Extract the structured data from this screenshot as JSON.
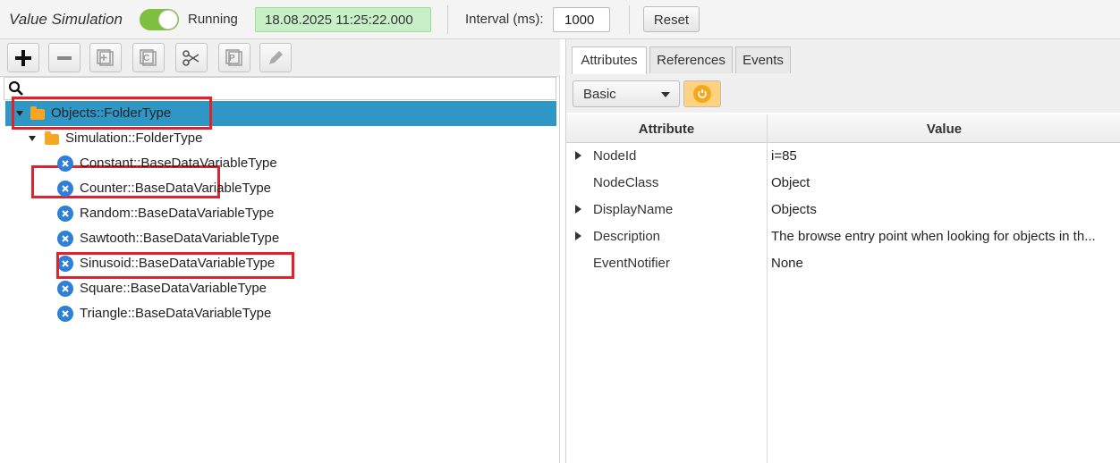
{
  "topbar": {
    "title": "Value Simulation",
    "status": "Running",
    "timestamp": "18.08.2025 11:25:22.000",
    "interval_label": "Interval (ms):",
    "interval_value": "1000",
    "reset_label": "Reset"
  },
  "toolbar": {
    "icons": [
      "plus-icon",
      "minus-icon",
      "add-box-icon",
      "copy-icon",
      "cut-icon",
      "paste-icon",
      "edit-icon"
    ]
  },
  "search": {
    "icon": "search-icon"
  },
  "tree": {
    "root": "Objects::FolderType",
    "folder": "Simulation::FolderType",
    "items": [
      "Constant::BaseDataVariableType",
      "Counter::BaseDataVariableType",
      "Random::BaseDataVariableType",
      "Sawtooth::BaseDataVariableType",
      "Sinusoid::BaseDataVariableType",
      "Square::BaseDataVariableType",
      "Triangle::BaseDataVariableType"
    ]
  },
  "tabs": [
    "Attributes",
    "References",
    "Events"
  ],
  "view_select": "Basic",
  "table": {
    "headers": [
      "Attribute",
      "Value"
    ],
    "rows": [
      {
        "attr": "NodeId",
        "value": "i=85"
      },
      {
        "attr": "NodeClass",
        "value": "Object"
      },
      {
        "attr": "DisplayName",
        "value": "Objects"
      },
      {
        "attr": "Description",
        "value": "The browse entry point when looking for objects in th..."
      },
      {
        "attr": "EventNotifier",
        "value": "None"
      }
    ]
  },
  "colors": {
    "selection": "#2e97c6",
    "highlight_box": "#e1222b",
    "toggle_on": "#7fbf3f",
    "timestamp_bg": "#c7f0c7",
    "refresh": "#f4a81d"
  }
}
